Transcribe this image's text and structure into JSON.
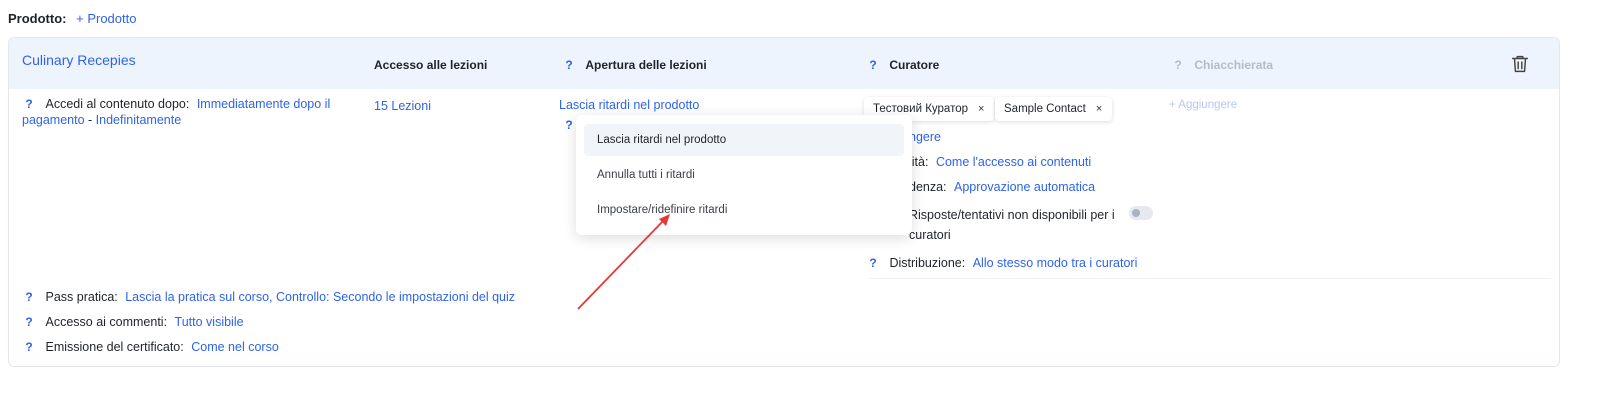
{
  "product_header": {
    "label": "Prodotto:",
    "add_link": "+ Prodotto"
  },
  "card": {
    "title": "Culinary Recepies",
    "columns": {
      "access": "Accesso alle lezioni",
      "opening": "Apertura delle lezioni",
      "curator": "Curatore",
      "chat": "Chiacchierata"
    },
    "access_after": {
      "label": "Accedi al contenuto dopo:",
      "value_line1": "Immediatamente dopo il",
      "value_line2": "pagamento",
      "separator": " - ",
      "value2": "Indefinitamente"
    },
    "lessons_link": "15 Lezioni",
    "opening_value": "Lascia ritardi nel prodotto",
    "curators": {
      "tags": [
        "Тестовий Куратор",
        "Sample Contact"
      ],
      "add": "+ Aggiungere",
      "add_partial": "ngere",
      "modality_label": "lità:",
      "modality_value": "Come l'accesso ai contenuti",
      "precedence_label": "denza:",
      "precedence_value": "Approvazione automatica",
      "answers_line1": "Risposte/tentativi non disponibili per i",
      "answers_line2": "curatori",
      "answers_toggle_on": false,
      "distribution_label": "Distribuzione:",
      "distribution_value": "Allo stesso modo tra i curatori"
    },
    "chat_add": "+ Aggiungere",
    "bottom": {
      "practice_label": "Pass pratica:",
      "practice_value": "Lascia la pratica sul corso, Controllo: Secondo le impostazioni del quiz",
      "comments_label": "Accesso ai commenti:",
      "comments_value": "Tutto visibile",
      "certificate_label": "Emissione del certificato:",
      "certificate_value": "Come nel corso"
    }
  },
  "dropdown": {
    "options": [
      "Lascia ritardi nel prodotto",
      "Annulla tutti i ritardi",
      "Impostare/ridefinire ritardi"
    ],
    "selected": "Lascia ritardi nel prodotto"
  },
  "help_glyph": "?",
  "close_glyph": "×",
  "icons": {
    "delete": "trash-icon",
    "help": "question-icon",
    "remove": "close-icon"
  },
  "colors": {
    "link": "#2f63e7",
    "header_bg": "#eef4fd",
    "arrow": "#e53935",
    "muted": "#b6bcc6"
  }
}
